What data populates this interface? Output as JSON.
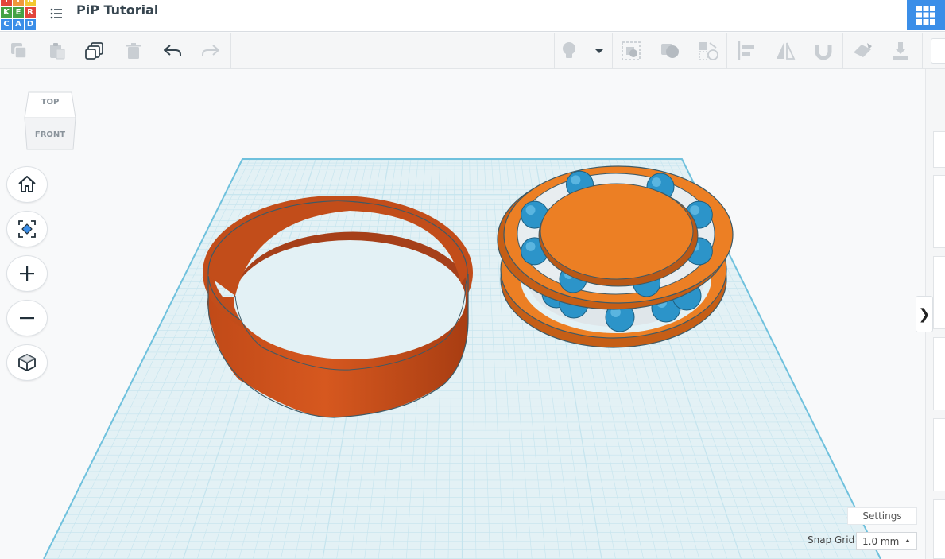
{
  "app": {
    "logo_letters": [
      "T",
      "I",
      "N",
      "K",
      "E",
      "R",
      "C",
      "A",
      "D"
    ],
    "logo_colors": [
      "#e2453c",
      "#f0983c",
      "#f2c830",
      "#44a245",
      "#44a245",
      "#e2453c",
      "#3b8ee8",
      "#3b8ee8",
      "#3b8ee8"
    ],
    "document_title": "PiP Tutorial",
    "accent_color": "#3b8ee8"
  },
  "toolbar": {
    "left_icons": [
      "copy-icon",
      "paste-icon",
      "duplicate-icon",
      "delete-icon",
      "undo-icon",
      "redo-icon"
    ],
    "right_icons": [
      "lightbulb-icon",
      "dropdown-caret-icon",
      "group-icon",
      "ungroup-icon",
      "hole-solid-icon",
      "align-icon",
      "mirror-icon",
      "magnet-icon",
      "workplane-icon",
      "import-icon"
    ]
  },
  "viewcube": {
    "top_label": "TOP",
    "front_label": "FRONT"
  },
  "nav": {
    "buttons": [
      "home-view",
      "fit-view",
      "zoom-in",
      "zoom-out",
      "perspective-toggle"
    ]
  },
  "scene": {
    "grid_color": "#c5e4ee",
    "plate_color": "#e3f1f5",
    "edge_color": "#6fc1dd",
    "ring_color": "#c94f1e",
    "bearing_orange": "#ec7f24",
    "ball_blue": "#2c94c9"
  },
  "panel": {
    "collapse_glyph": "❯"
  },
  "footer": {
    "settings_label": "Settings",
    "snap_grid_label": "Snap Grid",
    "snap_grid_value": "1.0 mm"
  }
}
